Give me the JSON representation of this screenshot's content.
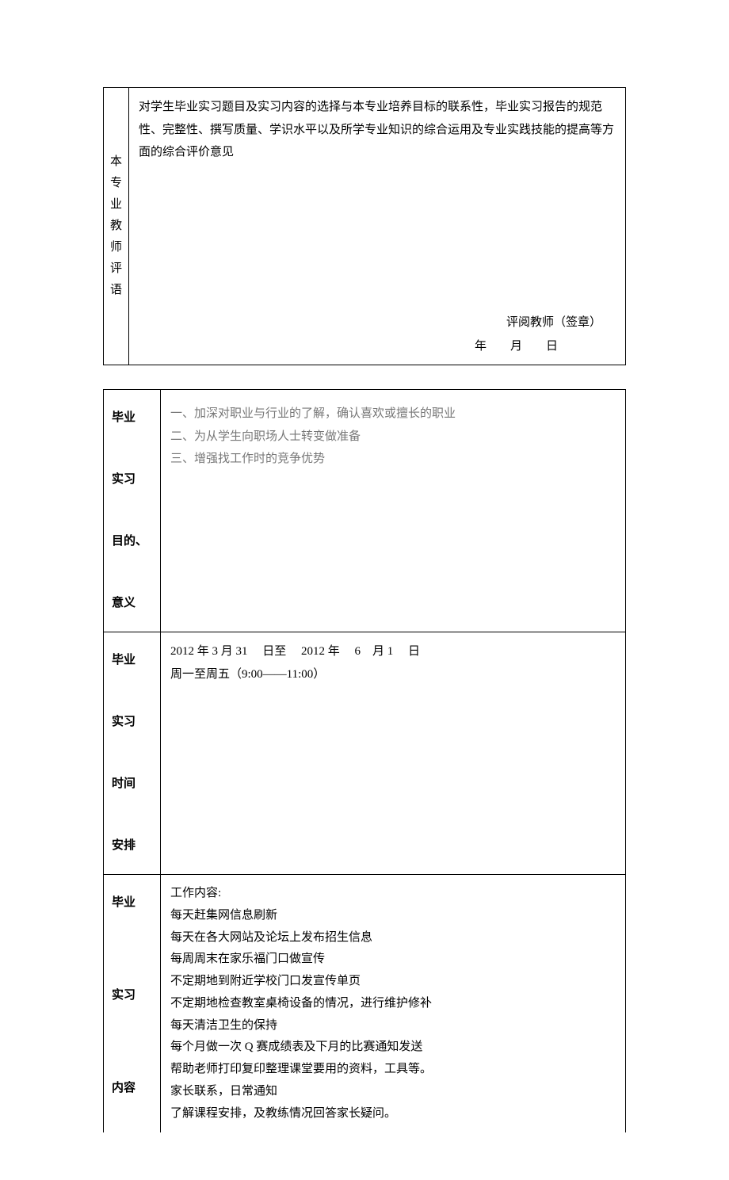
{
  "table1": {
    "row_label_chars": [
      "本",
      "专",
      "业",
      "教",
      "师",
      "评",
      "语"
    ],
    "p1": "对学生毕业实习题目及实习内容的选择与本专业培养目标的联系性，毕业实习报告的规范性、完整性、撰写质量、学识水平以及所学专业知识的综合运用及专业实践技能的提高等方面的综合评价意见",
    "sig1": "评阅教师（签章）",
    "sig2": "年　　月　　日"
  },
  "table2": {
    "row1_label": "毕业\n\n实习\n\n目的、\n\n意义",
    "row1_p1": "一、加深对职业与行业的了解，确认喜欢或擅长的职业",
    "row1_p2": "二、为从学生向职场人士转变做准备",
    "row1_p3": "三、增强找工作时的竞争优势",
    "row2_label": "毕业\n\n实习\n\n时间\n\n安排",
    "row2_p1": "2012 年  3  月 31　 日至　 2012 年　 6　月 1　 日",
    "row2_p2": "周一至周五（9:00——11:00）",
    "row3_label": "毕业\n\n\n实习\n\n\n内容",
    "row3_lines": [
      "工作内容:",
      "每天赶集网信息刷新",
      "每天在各大网站及论坛上发布招生信息",
      "每周周末在家乐福门口做宣传",
      "不定期地到附近学校门口发宣传单页",
      "不定期地检查教室桌椅设备的情况，进行维护修补",
      "每天清洁卫生的保持",
      "每个月做一次 Q 赛成绩表及下月的比赛通知发送",
      "帮助老师打印复印整理课堂要用的资料，工具等。",
      "家长联系，日常通知",
      "了解课程安排，及教练情况回答家长疑问。"
    ]
  }
}
